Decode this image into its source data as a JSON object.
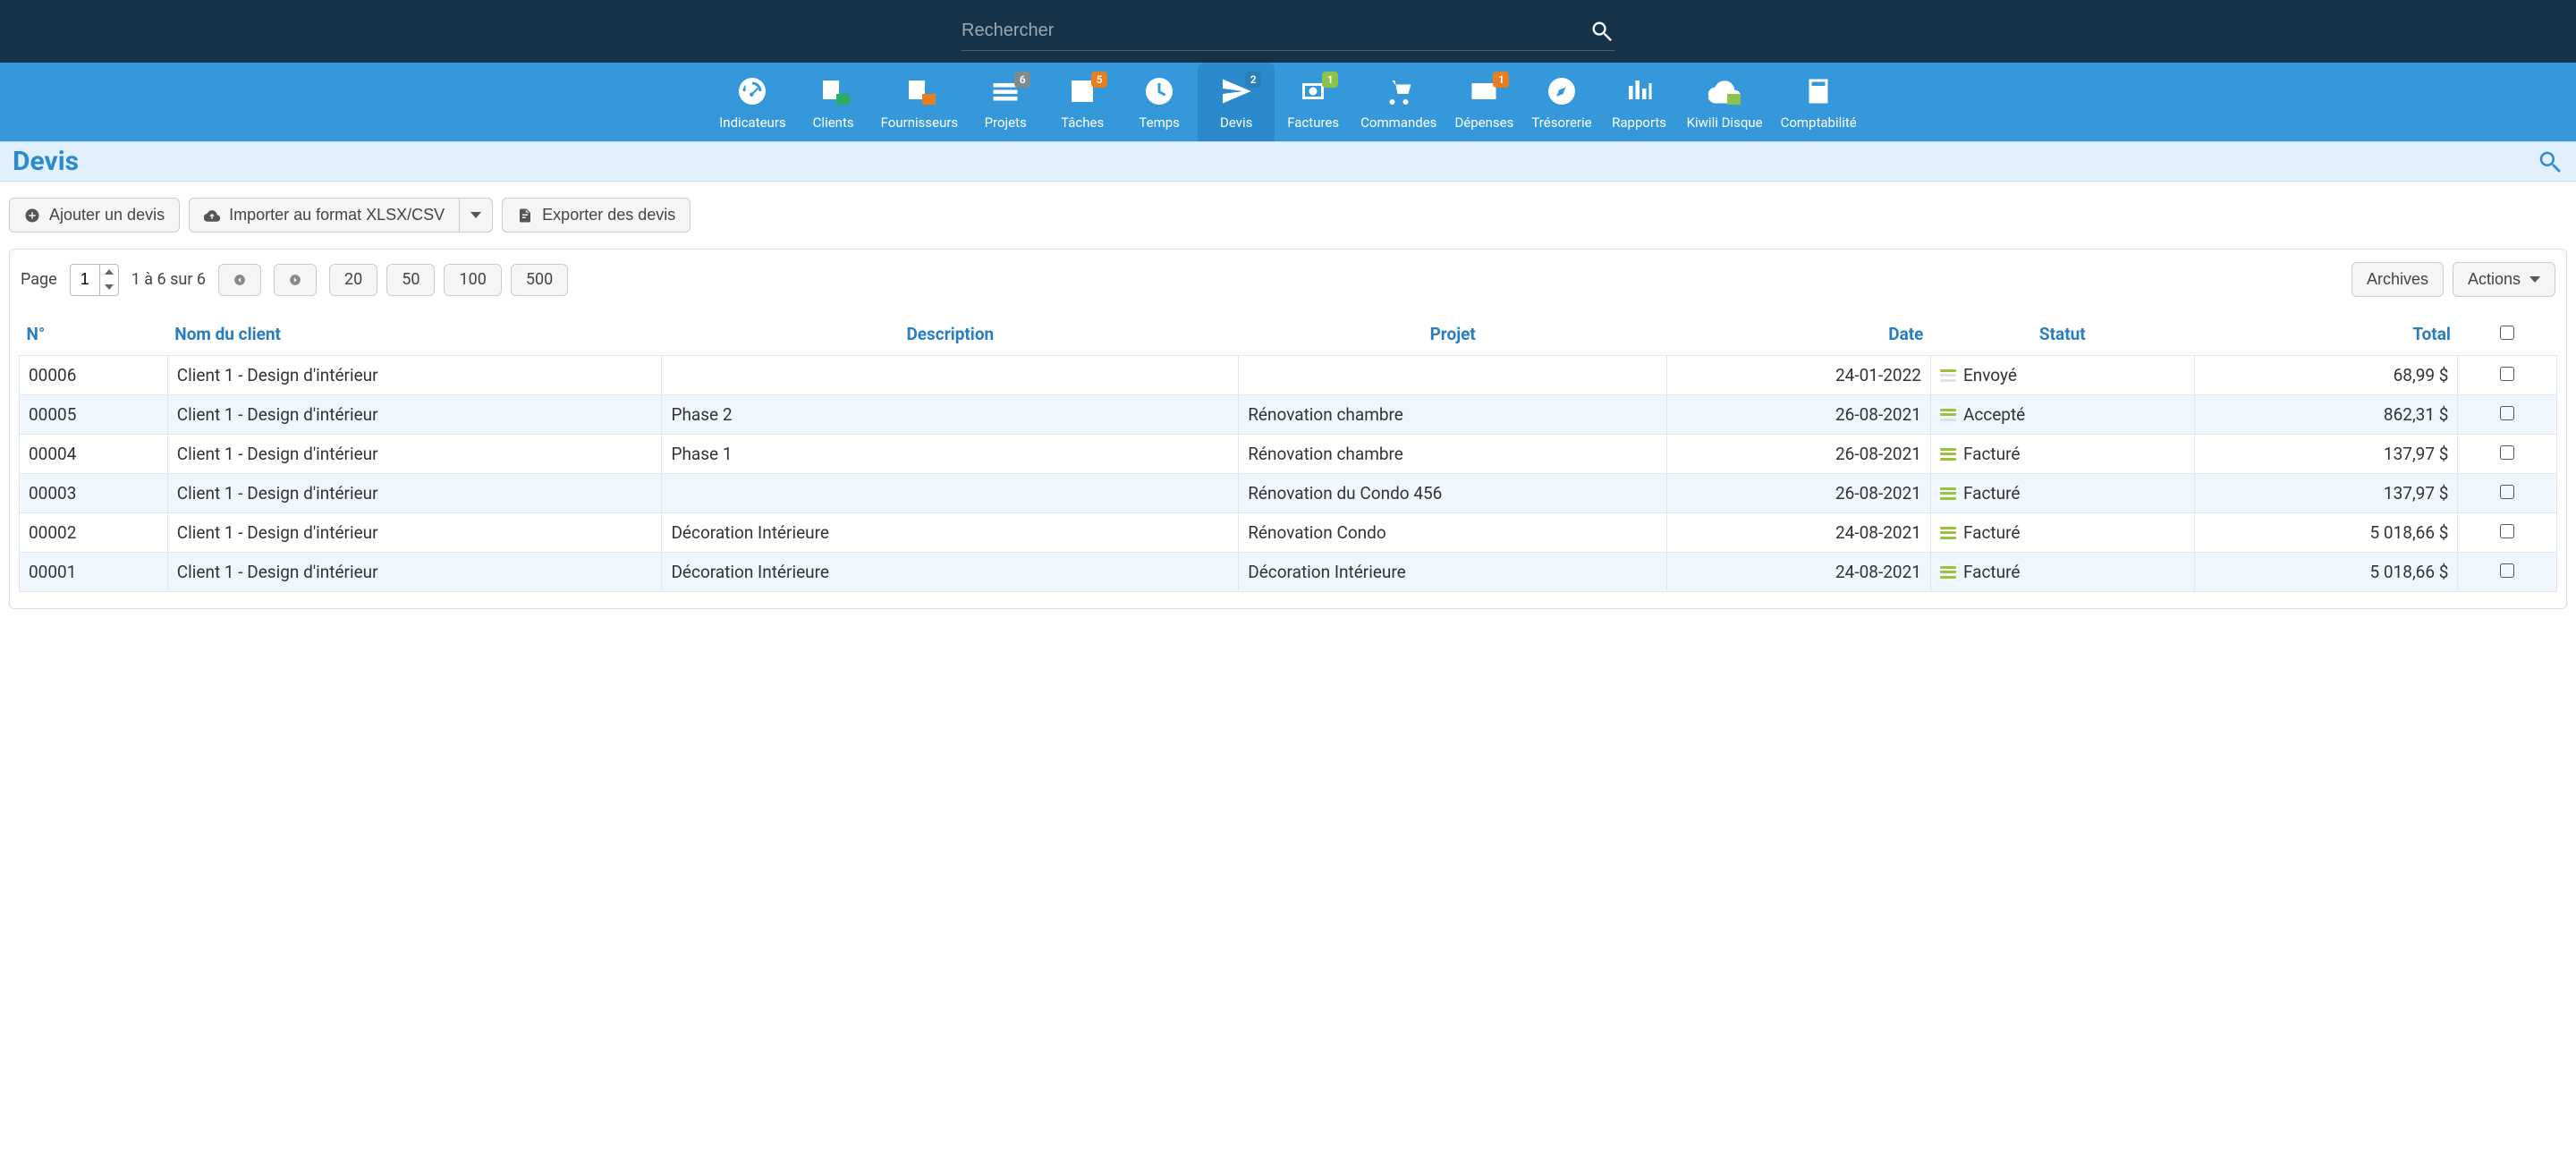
{
  "search": {
    "placeholder": "Rechercher"
  },
  "nav": [
    {
      "key": "indicateurs",
      "label": "Indicateurs",
      "icon": "dashboard"
    },
    {
      "key": "clients",
      "label": "Clients",
      "icon": "clients"
    },
    {
      "key": "fournisseurs",
      "label": "Fournisseurs",
      "icon": "suppliers"
    },
    {
      "key": "projets",
      "label": "Projets",
      "icon": "projects",
      "badge": "6",
      "badgeClass": "badge-gray"
    },
    {
      "key": "taches",
      "label": "Tâches",
      "icon": "tasks",
      "badge": "5",
      "badgeClass": "badge-orange"
    },
    {
      "key": "temps",
      "label": "Temps",
      "icon": "time"
    },
    {
      "key": "devis",
      "label": "Devis",
      "icon": "send",
      "badge": "2",
      "badgeClass": "badge-blue",
      "active": true
    },
    {
      "key": "factures",
      "label": "Factures",
      "icon": "money",
      "badge": "1",
      "badgeClass": "badge-green"
    },
    {
      "key": "commandes",
      "label": "Commandes",
      "icon": "cart"
    },
    {
      "key": "depenses",
      "label": "Dépenses",
      "icon": "card",
      "badge": "1",
      "badgeClass": "badge-orange"
    },
    {
      "key": "tresorerie",
      "label": "Trésorerie",
      "icon": "compass"
    },
    {
      "key": "rapports",
      "label": "Rapports",
      "icon": "bars"
    },
    {
      "key": "kiwili",
      "label": "Kiwili Disque",
      "icon": "cloud"
    },
    {
      "key": "compta",
      "label": "Comptabilité",
      "icon": "calc"
    }
  ],
  "page": {
    "title": "Devis"
  },
  "toolbar": {
    "add_label": "Ajouter un devis",
    "import_label": "Importer au format XLSX/CSV",
    "export_label": "Exporter des devis"
  },
  "pager": {
    "page_label": "Page",
    "page_value": "1",
    "range": "1 à 6 sur 6",
    "sizes": [
      "20",
      "50",
      "100",
      "500"
    ],
    "archives_label": "Archives",
    "actions_label": "Actions"
  },
  "columns": {
    "no": "N°",
    "client": "Nom du client",
    "desc": "Description",
    "projet": "Projet",
    "date": "Date",
    "statut": "Statut",
    "total": "Total"
  },
  "rows": [
    {
      "no": "00006",
      "client": "Client 1 - Design d'intérieur",
      "desc": "",
      "projet": "",
      "date": "24-01-2022",
      "statut": "Envoyé",
      "statusLevel": "envoye",
      "total": "68,99 $"
    },
    {
      "no": "00005",
      "client": "Client 1 - Design d'intérieur",
      "desc": "Phase 2",
      "projet": "Rénovation chambre",
      "date": "26-08-2021",
      "statut": "Accepté",
      "statusLevel": "accepte",
      "total": "862,31 $"
    },
    {
      "no": "00004",
      "client": "Client 1 - Design d'intérieur",
      "desc": "Phase 1",
      "projet": "Rénovation chambre",
      "date": "26-08-2021",
      "statut": "Facturé",
      "statusLevel": "facture",
      "total": "137,97 $"
    },
    {
      "no": "00003",
      "client": "Client 1 - Design d'intérieur",
      "desc": "",
      "projet": "Rénovation du Condo 456",
      "date": "26-08-2021",
      "statut": "Facturé",
      "statusLevel": "facture",
      "total": "137,97 $"
    },
    {
      "no": "00002",
      "client": "Client 1 - Design d'intérieur",
      "desc": "Décoration Intérieure",
      "projet": "Rénovation Condo",
      "date": "24-08-2021",
      "statut": "Facturé",
      "statusLevel": "facture",
      "total": "5 018,66 $"
    },
    {
      "no": "00001",
      "client": "Client 1 - Design d'intérieur",
      "desc": "Décoration Intérieure",
      "projet": "Décoration Intérieure",
      "date": "24-08-2021",
      "statut": "Facturé",
      "statusLevel": "facture",
      "total": "5 018,66 $"
    }
  ]
}
